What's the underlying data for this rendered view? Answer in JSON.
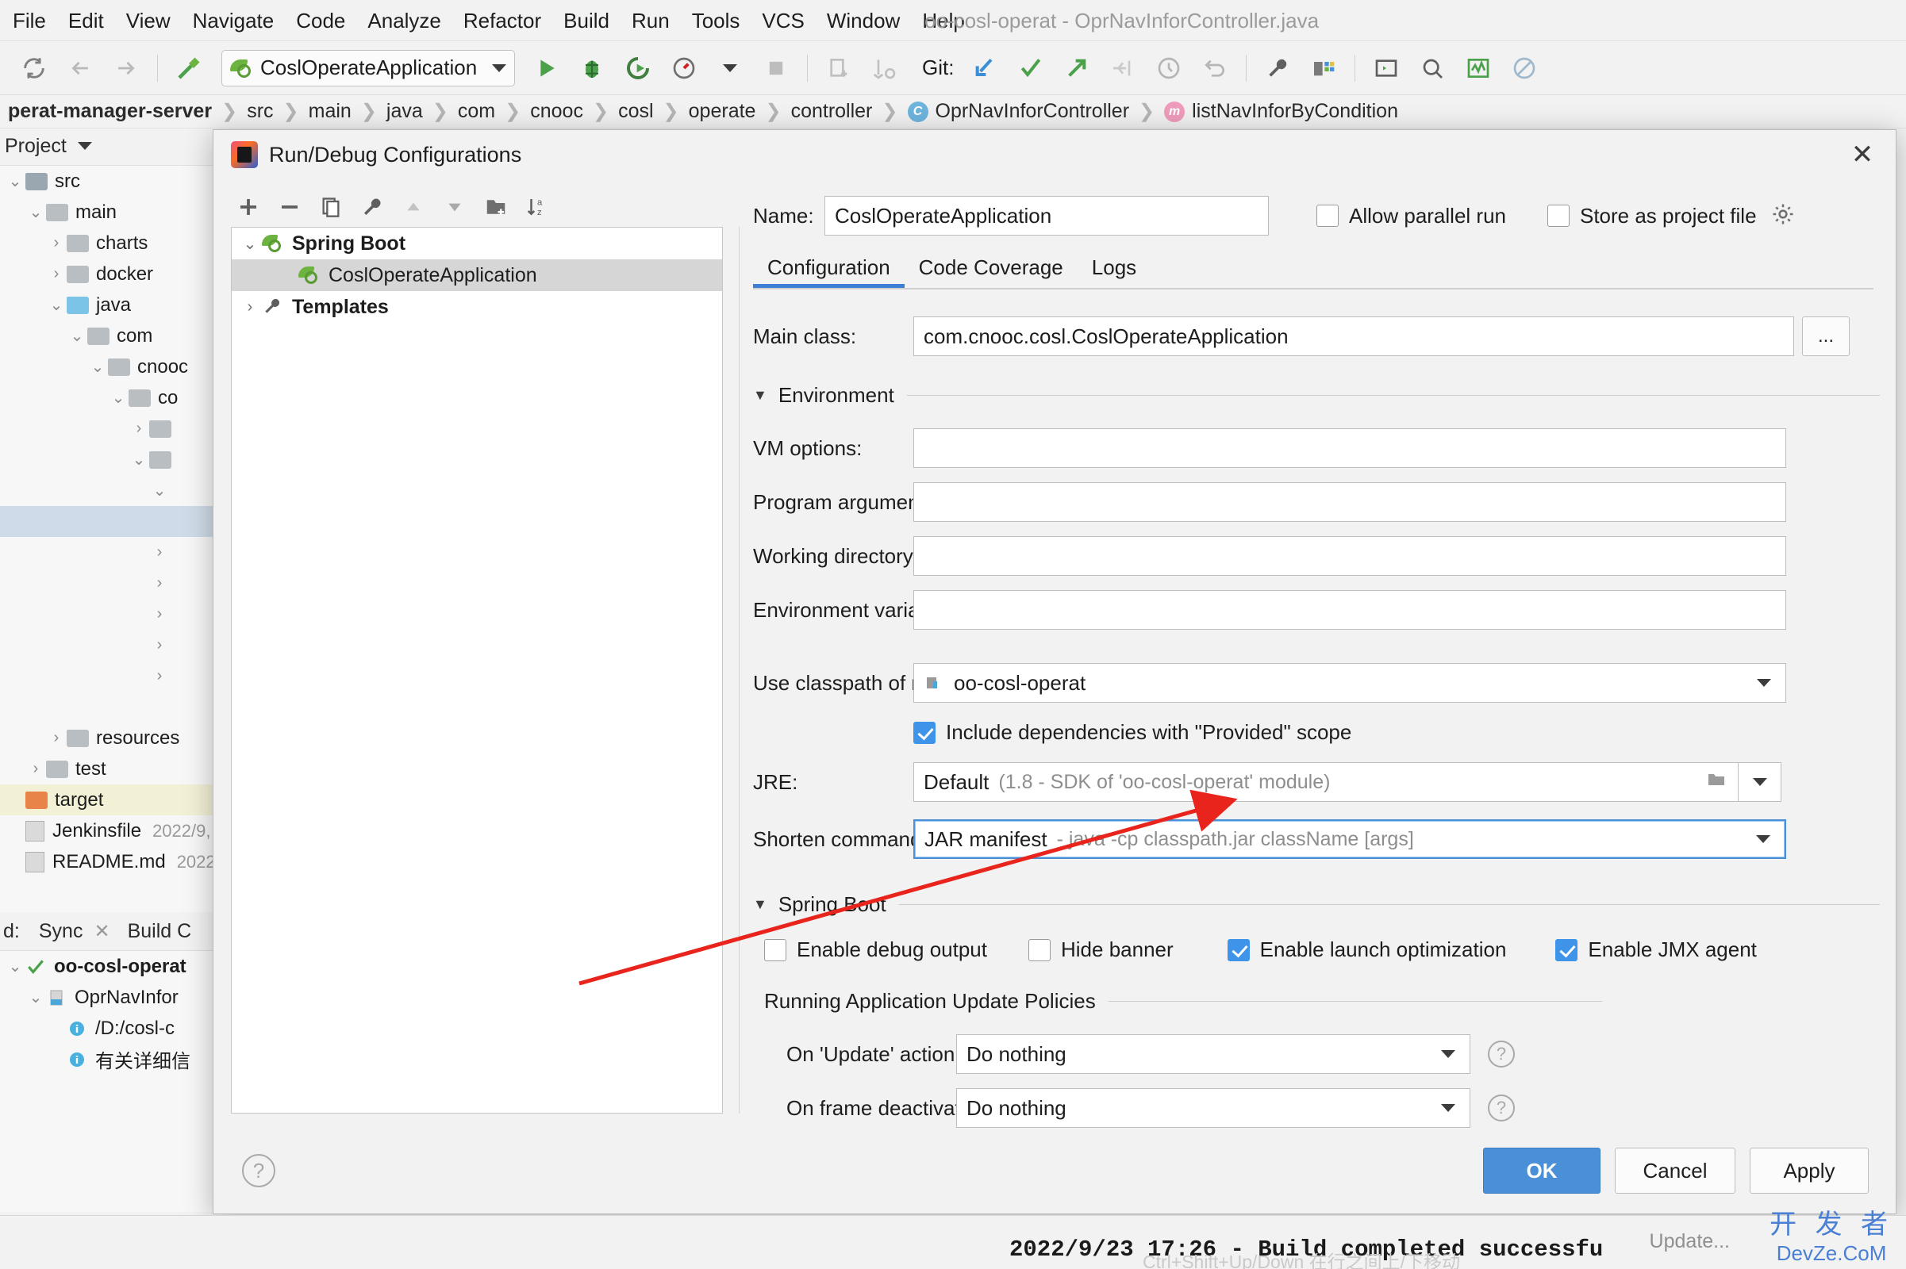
{
  "window": {
    "title": "oo-cosl-operat - OprNavInforController.java"
  },
  "menubar": {
    "items": [
      "File",
      "Edit",
      "View",
      "Navigate",
      "Code",
      "Analyze",
      "Refactor",
      "Build",
      "Run",
      "Tools",
      "VCS",
      "Window",
      "Help"
    ]
  },
  "toolbar": {
    "run_config": "CoslOperateApplication",
    "git_label": "Git:",
    "icons": [
      "sync-icon",
      "back-arrow-icon",
      "forward-arrow-icon",
      "build-hammer-icon",
      "run-icon",
      "debug-icon",
      "run-coverage-icon",
      "profiler-icon",
      "stop-icon",
      "update-app-icon",
      "rerun-icon",
      "git-update-icon",
      "git-commit-icon",
      "git-push-icon",
      "git-checkout-icon",
      "git-history-icon",
      "git-rollback-icon",
      "settings-wrench-icon",
      "project-structure-icon",
      "terminal-icon",
      "search-icon",
      "analyze-icon",
      "no-entry-icon"
    ]
  },
  "breadcrumb": {
    "items": [
      {
        "label": "perat-manager-server",
        "bold": true,
        "badge": ""
      },
      {
        "label": "src",
        "bold": false,
        "badge": ""
      },
      {
        "label": "main",
        "bold": false,
        "badge": ""
      },
      {
        "label": "java",
        "bold": false,
        "badge": ""
      },
      {
        "label": "com",
        "bold": false,
        "badge": ""
      },
      {
        "label": "cnooc",
        "bold": false,
        "badge": ""
      },
      {
        "label": "cosl",
        "bold": false,
        "badge": ""
      },
      {
        "label": "operate",
        "bold": false,
        "badge": ""
      },
      {
        "label": "controller",
        "bold": false,
        "badge": ""
      },
      {
        "label": "OprNavInforController",
        "bold": false,
        "badge": "C"
      },
      {
        "label": "listNavInforByCondition",
        "bold": false,
        "badge": "m"
      }
    ]
  },
  "project_panel": {
    "title": "Project",
    "nodes": [
      {
        "label": "src",
        "indent": 0,
        "arrow": "v",
        "folder": "f-src",
        "state": ""
      },
      {
        "label": "main",
        "indent": 1,
        "arrow": "v",
        "folder": "f-grey",
        "state": ""
      },
      {
        "label": "charts",
        "indent": 2,
        "arrow": ">",
        "folder": "f-grey",
        "state": ""
      },
      {
        "label": "docker",
        "indent": 2,
        "arrow": ">",
        "folder": "f-grey",
        "state": ""
      },
      {
        "label": "java",
        "indent": 2,
        "arrow": "v",
        "folder": "f-blue",
        "state": ""
      },
      {
        "label": "com",
        "indent": 3,
        "arrow": "v",
        "folder": "f-grey",
        "state": ""
      },
      {
        "label": "cnooc",
        "indent": 4,
        "arrow": "v",
        "folder": "f-grey",
        "state": ""
      },
      {
        "label": "co",
        "indent": 5,
        "arrow": "v",
        "folder": "f-grey",
        "state": ""
      },
      {
        "label": "",
        "indent": 6,
        "arrow": ">",
        "folder": "f-grey",
        "state": ""
      },
      {
        "label": "",
        "indent": 6,
        "arrow": "v",
        "folder": "f-grey",
        "state": ""
      },
      {
        "label": "",
        "indent": 7,
        "arrow": "v",
        "folder": "",
        "state": ""
      },
      {
        "label": "",
        "indent": 7,
        "arrow": "",
        "folder": "",
        "state": "sel-blue"
      },
      {
        "label": "",
        "indent": 7,
        "arrow": ">",
        "folder": "",
        "state": ""
      },
      {
        "label": "",
        "indent": 7,
        "arrow": ">",
        "folder": "",
        "state": ""
      },
      {
        "label": "",
        "indent": 7,
        "arrow": ">",
        "folder": "",
        "state": ""
      },
      {
        "label": "",
        "indent": 7,
        "arrow": ">",
        "folder": "",
        "state": ""
      },
      {
        "label": "",
        "indent": 7,
        "arrow": ">",
        "folder": "",
        "state": ""
      },
      {
        "label": "",
        "indent": 7,
        "arrow": "",
        "folder": "",
        "state": ""
      },
      {
        "label": "resources",
        "indent": 2,
        "arrow": ">",
        "folder": "f-res",
        "state": ""
      },
      {
        "label": "test",
        "indent": 1,
        "arrow": ">",
        "folder": "f-grey",
        "state": ""
      },
      {
        "label": "target",
        "indent": 0,
        "arrow": "",
        "folder": "f-orange",
        "state": "sel-yellow"
      }
    ],
    "files": [
      {
        "label": "Jenkinsfile",
        "date": "2022/9,"
      },
      {
        "label": "README.md",
        "date": "2022"
      }
    ]
  },
  "build_panel": {
    "label": "d:",
    "tabs": [
      "Sync",
      "Build C"
    ],
    "nodes": [
      {
        "label": "oo-cosl-operat",
        "indent": 0,
        "arrow": "v",
        "icon": "check-green-icon",
        "bold": true
      },
      {
        "label": "OprNavInfor",
        "indent": 1,
        "arrow": "v",
        "icon": "file-java-icon",
        "bold": false
      },
      {
        "label": "/D:/cosl-c",
        "indent": 2,
        "arrow": "",
        "icon": "info-icon",
        "bold": false
      },
      {
        "label": "有关详细信",
        "indent": 2,
        "arrow": "",
        "icon": "info-icon",
        "bold": false
      }
    ]
  },
  "dialog": {
    "title": "Run/Debug Configurations",
    "close_icon": "✕",
    "config_toolbar_icons": [
      "add-icon",
      "remove-icon",
      "copy-icon",
      "edit-templates-icon",
      "move-up-icon",
      "move-down-icon",
      "new-folder-icon",
      "sort-alphabetically-icon"
    ],
    "tree": [
      {
        "label": "Spring Boot",
        "indent": 0,
        "arrow": "v",
        "bold": true,
        "selected": false
      },
      {
        "label": "CoslOperateApplication",
        "indent": 1,
        "arrow": "",
        "bold": false,
        "selected": true
      },
      {
        "label": "Templates",
        "indent": 0,
        "arrow": ">",
        "bold": true,
        "selected": false
      }
    ],
    "name_label": "Name:",
    "name_value": "CoslOperateApplication",
    "allow_parallel_run": "Allow parallel run",
    "allow_parallel_run_checked": false,
    "store_as_project_file": "Store as project file",
    "store_as_project_file_checked": false,
    "tabs": [
      {
        "label": "Configuration",
        "active": true
      },
      {
        "label": "Code Coverage",
        "active": false
      },
      {
        "label": "Logs",
        "active": false
      }
    ],
    "main_class_label": "Main class:",
    "main_class_value": "com.cnooc.cosl.CoslOperateApplication",
    "browse_button": "...",
    "environment_section": "Environment",
    "vm_options_label": "VM options:",
    "vm_options_value": "",
    "program_arguments_label": "Program arguments:",
    "program_arguments_value": "",
    "working_directory_label": "Working directory:",
    "working_directory_value": "",
    "environment_variables_label": "Environment variables:",
    "environment_variables_value": "",
    "use_classpath_label": "Use classpath of module:",
    "use_classpath_value": "oo-cosl-operat",
    "include_provided_label": "Include dependencies with \"Provided\" scope",
    "include_provided_checked": true,
    "jre_label": "JRE:",
    "jre_value": "Default",
    "jre_value_sub": "(1.8 - SDK of 'oo-cosl-operat' module)",
    "shorten_cmd_label": "Shorten command line:",
    "shorten_cmd_value": "JAR manifest",
    "shorten_cmd_sub": "- java -cp classpath.jar className [args]",
    "spring_boot_section": "Spring Boot",
    "spring_checkboxes": [
      {
        "label": "Enable debug output",
        "checked": false
      },
      {
        "label": "Hide banner",
        "checked": false
      },
      {
        "label": "Enable launch optimization",
        "checked": true
      },
      {
        "label": "Enable JMX agent",
        "checked": true
      }
    ],
    "update_policies_section": "Running Application Update Policies",
    "on_update_label": "On 'Update' action:",
    "on_update_value": "Do nothing",
    "on_frame_label": "On frame deactivation:",
    "on_frame_value": "Do nothing",
    "help_icon": "?",
    "buttons": {
      "ok": "OK",
      "cancel": "Cancel",
      "apply": "Apply"
    }
  },
  "statusbar": {
    "build_message": "2022/9/23 17:26 - Build completed successfu",
    "hint": "Ctrl+Shift+Up/Down 在行之间上/下移动",
    "update": "Update...",
    "watermark_cn": "开 发 者",
    "watermark_en": "DevZe.CoM"
  },
  "colors": {
    "accent_blue": "#4a90d9",
    "checkbox_blue": "#3d94e8",
    "arrow_red": "#e8241c",
    "spring_green": "#6cb33f"
  }
}
